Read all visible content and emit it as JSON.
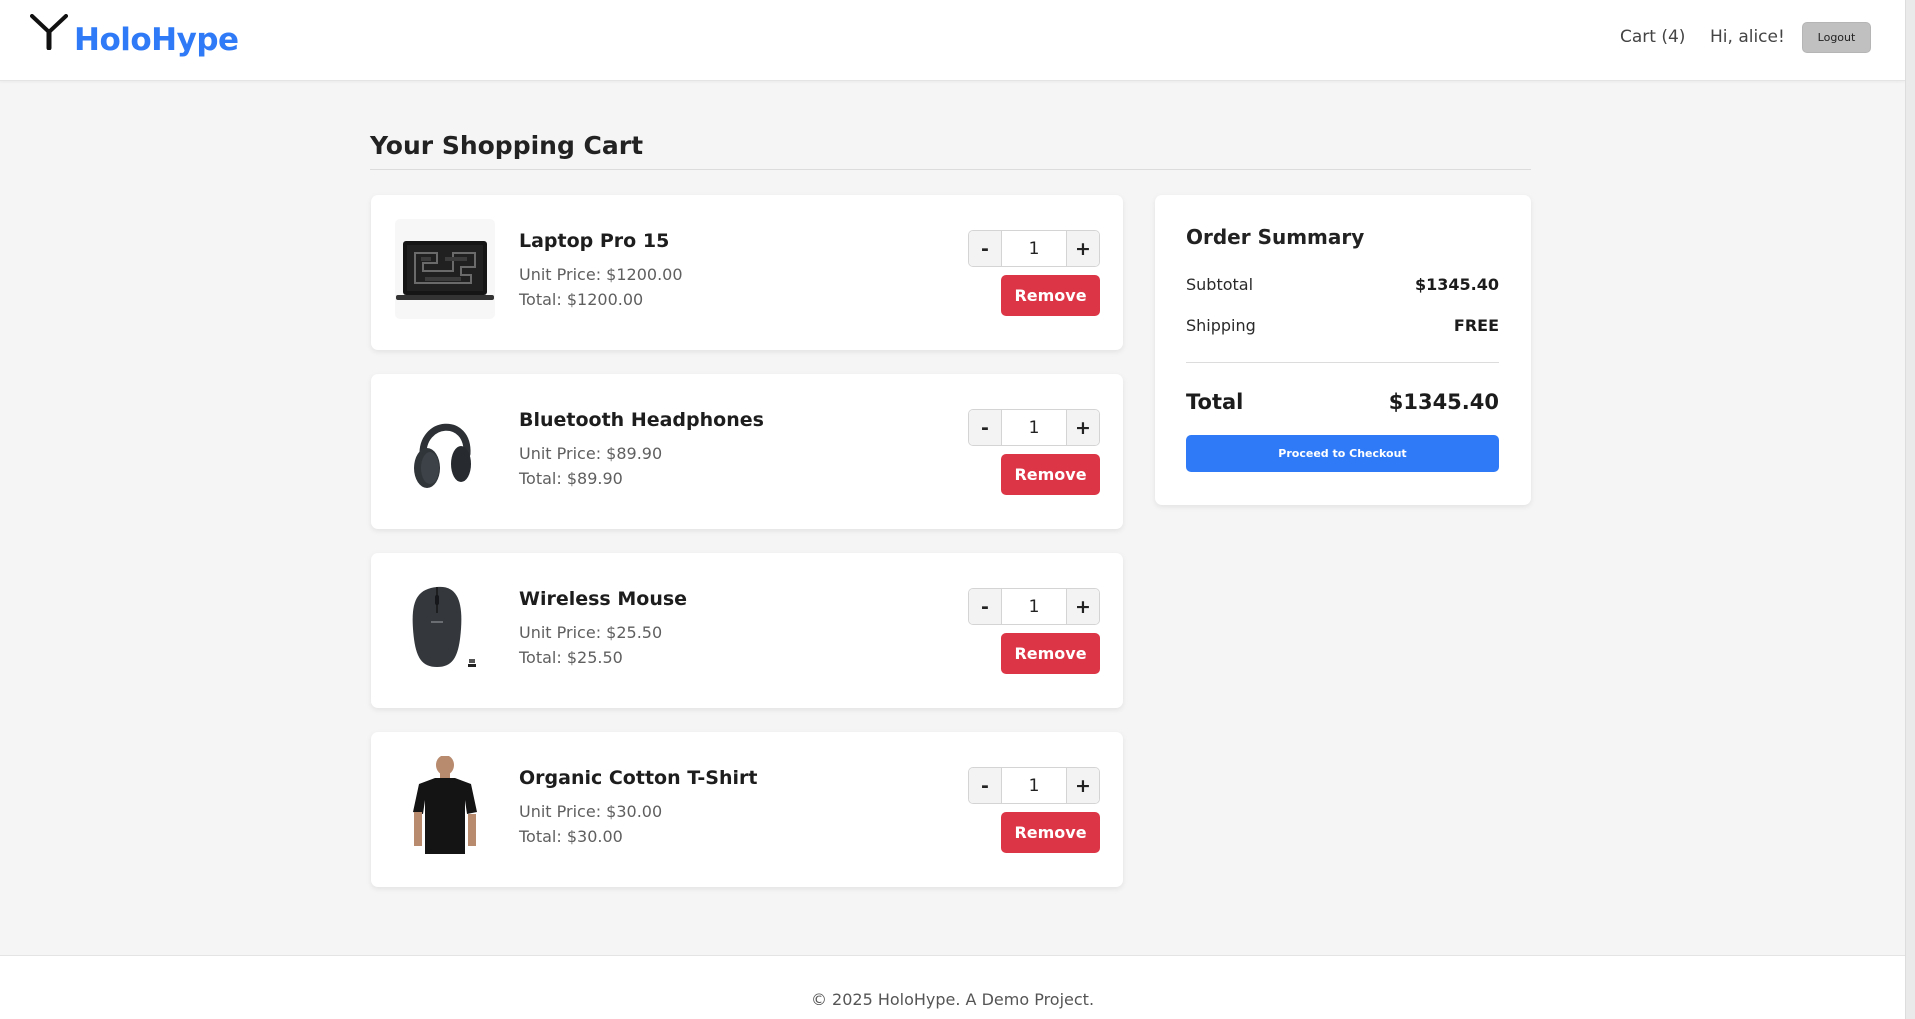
{
  "brand": {
    "name": "HoloHype",
    "logo_icon": "y-logo-icon",
    "color": "#2f7af6"
  },
  "nav": {
    "cart_label": "Cart (4)",
    "greeting": "Hi, alice!",
    "logout_label": "Logout"
  },
  "page": {
    "title": "Your Shopping Cart"
  },
  "cart": {
    "items": [
      {
        "name": "Laptop Pro 15",
        "unit_price": "Unit Price: $1200.00",
        "total": "Total: $1200.00",
        "quantity": "1",
        "image": "laptop-image"
      },
      {
        "name": "Bluetooth Headphones",
        "unit_price": "Unit Price: $89.90",
        "total": "Total: $89.90",
        "quantity": "1",
        "image": "headphones-image"
      },
      {
        "name": "Wireless Mouse",
        "unit_price": "Unit Price: $25.50",
        "total": "Total: $25.50",
        "quantity": "1",
        "image": "mouse-image"
      },
      {
        "name": "Organic Cotton T-Shirt",
        "unit_price": "Unit Price: $30.00",
        "total": "Total: $30.00",
        "quantity": "1",
        "image": "tshirt-image"
      }
    ],
    "decrease_label": "-",
    "increase_label": "+",
    "remove_label": "Remove",
    "remove_color": "#dc3545"
  },
  "summary": {
    "title": "Order Summary",
    "subtotal_label": "Subtotal",
    "subtotal_value": "$1345.40",
    "shipping_label": "Shipping",
    "shipping_value": "FREE",
    "total_label": "Total",
    "total_value": "$1345.40",
    "checkout_label": "Proceed to Checkout"
  },
  "footer": {
    "text": "© 2025 HoloHype. A Demo Project."
  }
}
